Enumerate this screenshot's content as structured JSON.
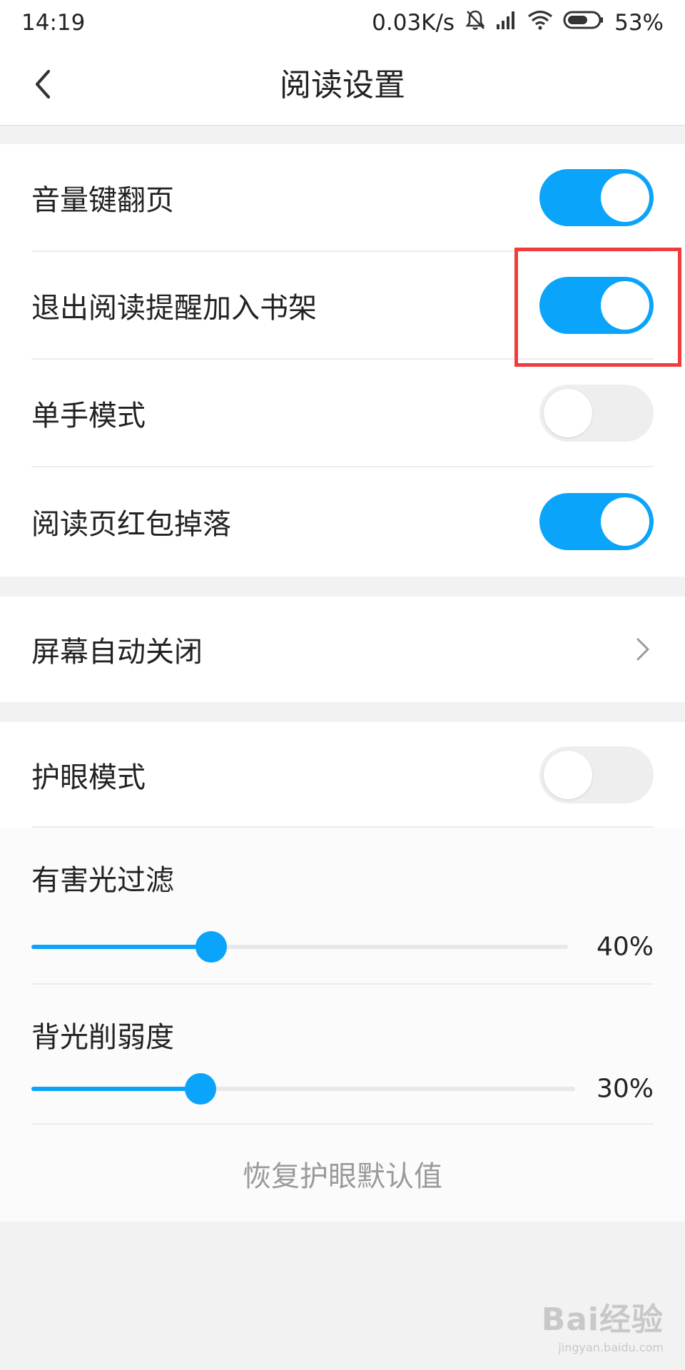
{
  "status_bar": {
    "time": "14:19",
    "network_speed": "0.03K/s",
    "battery": "53%",
    "icons": [
      "mute-bell-icon",
      "signal-icon",
      "wifi-icon",
      "battery-icon"
    ]
  },
  "nav": {
    "title": "阅读设置",
    "back_icon": "back-arrow-icon"
  },
  "section1": {
    "items": [
      {
        "label": "音量键翻页",
        "toggle": "on"
      },
      {
        "label": "退出阅读提醒加入书架",
        "toggle": "on"
      },
      {
        "label": "单手模式",
        "toggle": "off"
      },
      {
        "label": "阅读页红包掉落",
        "toggle": "on"
      }
    ]
  },
  "section2": {
    "items": [
      {
        "label": "屏幕自动关闭",
        "icon": "chevron-right-icon"
      }
    ]
  },
  "section3": {
    "eye_mode": {
      "label": "护眼模式",
      "toggle": "off"
    },
    "sliders": [
      {
        "label": "有害光过滤",
        "value_text": "40%",
        "value": 0.4
      },
      {
        "label": "背光削弱度",
        "value_text": "30%",
        "value": 0.3
      }
    ],
    "reset_label": "恢复护眼默认值"
  },
  "watermark": {
    "brand": "Bai经验",
    "url": "jingyan.baidu.com"
  },
  "colors": {
    "accent": "#0aa4fa",
    "toggle_off": "#eeeeee",
    "highlight": "#f03c3c",
    "background": "#f2f2f2"
  }
}
